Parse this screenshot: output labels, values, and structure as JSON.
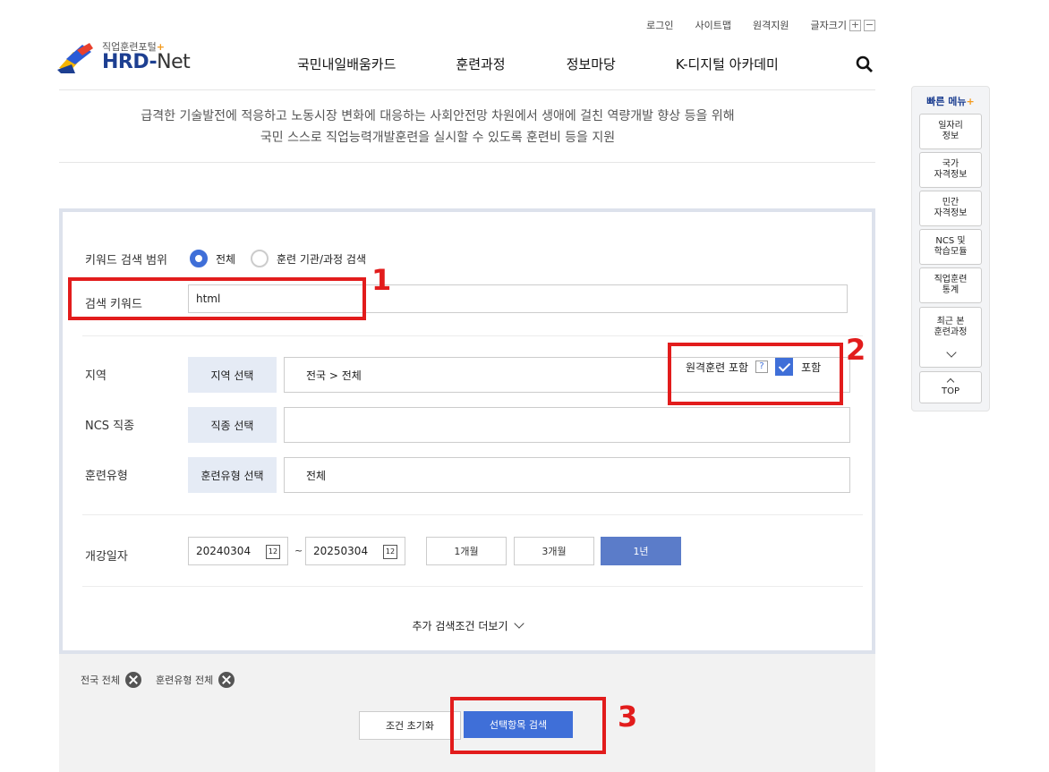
{
  "util": {
    "login": "로그인",
    "sitemap": "사이트맵",
    "remote": "원격지원",
    "fontsize": "글자크기",
    "plus": "+",
    "minus": "−"
  },
  "logo": {
    "sub": "직업훈련포털",
    "main": "HRD-",
    "net": "Net"
  },
  "gnb": [
    "국민내일배움카드",
    "훈련과정",
    "정보마당",
    "K-디지털 아카데미"
  ],
  "intro": {
    "line1": "급격한 기술발전에 적응하고 노동시장 변화에 대응하는 사회안전망 차원에서 생애에 걸친 역량개발 향상 등을 위해",
    "line2": "국민 스스로 직업능력개발훈련을 실시할 수 있도록 훈련비 등을 지원"
  },
  "search": {
    "scope_label": "키워드 검색 범위",
    "scope_all": "전체",
    "scope_inst": "훈련 기관/과정 검색",
    "keyword_label": "검색 키워드",
    "keyword_value": "html",
    "region_label": "지역",
    "region_btn": "지역 선택",
    "region_value": "전국 > 전체",
    "remote_label": "원격훈련 포함",
    "remote_help": "?",
    "remote_check_label": "포함",
    "ncs_label": "NCS 직종",
    "ncs_btn": "직종 선택",
    "type_label": "훈련유형",
    "type_btn": "훈련유형 선택",
    "type_value": "전체",
    "date_label": "개강일자",
    "date_from": "20240304",
    "date_to": "20250304",
    "date_tilde": "~",
    "cal_icon_text": "12",
    "period_1m": "1개월",
    "period_3m": "3개월",
    "period_1y": "1년",
    "more_label": "추가 검색조건 더보기"
  },
  "bottom": {
    "tag_region": "전국 전체",
    "tag_type": "훈련유형 전체",
    "reset": "조건 초기화",
    "submit": "선택항목 검색"
  },
  "annotations": {
    "n1": "1",
    "n2": "2",
    "n3": "3"
  },
  "quick": {
    "title": "빠른 메뉴",
    "title_plus": "+",
    "items": [
      "일자리\n정보",
      "국가\n자격정보",
      "민간\n자격정보",
      "NCS 및\n학습모듈",
      "직업훈련\n통계",
      "최근 본\n훈련과정"
    ],
    "top": "TOP"
  }
}
